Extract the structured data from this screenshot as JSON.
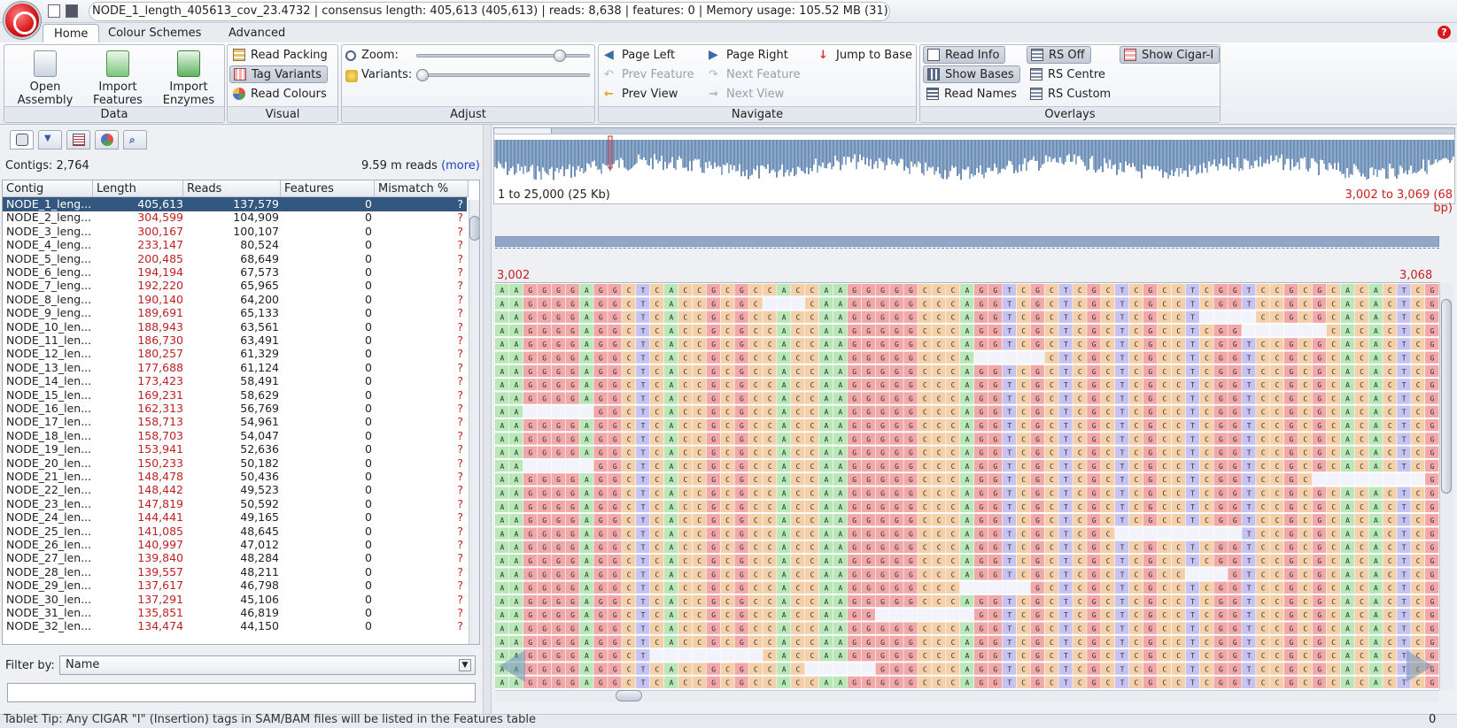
{
  "window": {
    "title": "NODE_1_length_405613_cov_23.4732  |  consensus length: 405,613 (405,613)  |  reads: 8,638  |  features: 0  |  Memory usage: 105.52 MB (31)"
  },
  "tabs": [
    "Home",
    "Colour Schemes",
    "Advanced"
  ],
  "ribbon": {
    "data_group": {
      "label": "Data",
      "open_assembly": "Open\nAssembly",
      "import_features": "Import\nFeatures",
      "import_enzymes": "Import\nEnzymes"
    },
    "visual_group": {
      "label": "Visual",
      "read_packing": "Read Packing",
      "tag_variants": "Tag Variants",
      "read_colours": "Read Colours"
    },
    "adjust_group": {
      "label": "Adjust",
      "zoom_label": "Zoom:",
      "variants_label": "Variants:",
      "zoom_level": 0.85,
      "variants_level": 0.0
    },
    "navigate_group": {
      "label": "Navigate",
      "page_left": "Page Left",
      "page_right": "Page Right",
      "jump_to_base": "Jump to Base",
      "prev_feature": "Prev Feature",
      "next_feature": "Next Feature",
      "prev_view": "Prev View",
      "next_view": "Next View"
    },
    "overlays_group": {
      "label": "Overlays",
      "read_info": "Read Info",
      "rs_off": "RS Off",
      "show_cigar": "Show Cigar-I",
      "show_bases": "Show Bases",
      "rs_centre": "RS Centre",
      "read_names": "Read Names",
      "rs_custom": "RS Custom"
    }
  },
  "left_panel": {
    "contigs_count": "Contigs: 2,764",
    "reads_total": "9.59 m reads",
    "more_link": "(more)",
    "columns": [
      "Contig",
      "Length",
      "Reads",
      "Features",
      "Mismatch %"
    ],
    "rows": [
      [
        "NODE_1_leng...",
        "405,613",
        "137,579",
        "0",
        "?"
      ],
      [
        "NODE_2_leng...",
        "304,599",
        "104,909",
        "0",
        "?"
      ],
      [
        "NODE_3_leng...",
        "300,167",
        "100,107",
        "0",
        "?"
      ],
      [
        "NODE_4_leng...",
        "233,147",
        "80,524",
        "0",
        "?"
      ],
      [
        "NODE_5_leng...",
        "200,485",
        "68,649",
        "0",
        "?"
      ],
      [
        "NODE_6_leng...",
        "194,194",
        "67,573",
        "0",
        "?"
      ],
      [
        "NODE_7_leng...",
        "192,220",
        "65,965",
        "0",
        "?"
      ],
      [
        "NODE_8_leng...",
        "190,140",
        "64,200",
        "0",
        "?"
      ],
      [
        "NODE_9_leng...",
        "189,691",
        "65,133",
        "0",
        "?"
      ],
      [
        "NODE_10_len...",
        "188,943",
        "63,561",
        "0",
        "?"
      ],
      [
        "NODE_11_len...",
        "186,730",
        "63,491",
        "0",
        "?"
      ],
      [
        "NODE_12_len...",
        "180,257",
        "61,329",
        "0",
        "?"
      ],
      [
        "NODE_13_len...",
        "177,688",
        "61,124",
        "0",
        "?"
      ],
      [
        "NODE_14_len...",
        "173,423",
        "58,491",
        "0",
        "?"
      ],
      [
        "NODE_15_len...",
        "169,231",
        "58,629",
        "0",
        "?"
      ],
      [
        "NODE_16_len...",
        "162,313",
        "56,769",
        "0",
        "?"
      ],
      [
        "NODE_17_len...",
        "158,713",
        "54,961",
        "0",
        "?"
      ],
      [
        "NODE_18_len...",
        "158,703",
        "54,047",
        "0",
        "?"
      ],
      [
        "NODE_19_len...",
        "153,941",
        "52,636",
        "0",
        "?"
      ],
      [
        "NODE_20_len...",
        "150,233",
        "50,182",
        "0",
        "?"
      ],
      [
        "NODE_21_len...",
        "148,478",
        "50,436",
        "0",
        "?"
      ],
      [
        "NODE_22_len...",
        "148,442",
        "49,523",
        "0",
        "?"
      ],
      [
        "NODE_23_len...",
        "147,819",
        "50,592",
        "0",
        "?"
      ],
      [
        "NODE_24_len...",
        "144,441",
        "49,165",
        "0",
        "?"
      ],
      [
        "NODE_25_len...",
        "141,085",
        "48,645",
        "0",
        "?"
      ],
      [
        "NODE_26_len...",
        "140,997",
        "47,012",
        "0",
        "?"
      ],
      [
        "NODE_27_len...",
        "139,840",
        "48,284",
        "0",
        "?"
      ],
      [
        "NODE_28_len...",
        "139,557",
        "48,211",
        "0",
        "?"
      ],
      [
        "NODE_29_len...",
        "137,617",
        "46,798",
        "0",
        "?"
      ],
      [
        "NODE_30_len...",
        "137,291",
        "45,106",
        "0",
        "?"
      ],
      [
        "NODE_31_len...",
        "135,851",
        "46,819",
        "0",
        "?"
      ],
      [
        "NODE_32_len...",
        "134,474",
        "44,150",
        "0",
        "?"
      ]
    ],
    "filter_label": "Filter by:",
    "filter_value": "Name",
    "filter_text": ""
  },
  "overview": {
    "range_left": "1 to 25,000 (25 Kb)",
    "range_right": "3,002 to 3,069 (68 bp)"
  },
  "reads_view": {
    "start_pos": "3,002",
    "end_pos": "3,068",
    "consensus": "AAGGGGAGGCTCACCGCGCCACCAAGGGGGCCCAGGTCGCTCGCTCGCCTCGGTCCGCGCACACTCG",
    "colors": {
      "A": "#b8e8b8",
      "G": "#f2a8a8",
      "C": "#f5cfa8",
      "T": "#c6c3f2"
    }
  },
  "status": {
    "tip": "Tablet Tip: Any CIGAR \"I\" (Insertion) tags in SAM/BAM files will be listed in the Features table",
    "counter": "0"
  }
}
